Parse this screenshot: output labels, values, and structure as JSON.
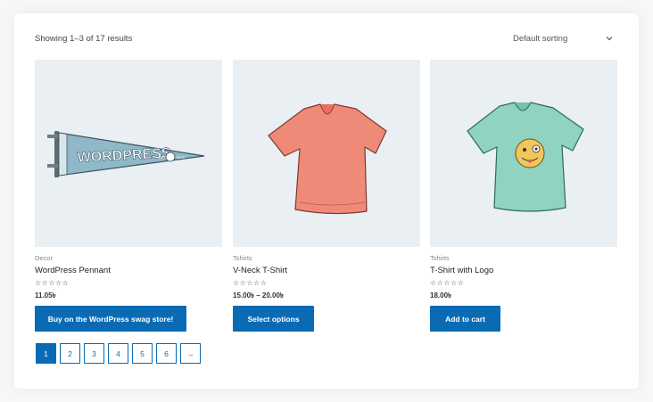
{
  "toolbar": {
    "result_count": "Showing 1–3 of 17 results",
    "sorting_selected": "Default sorting"
  },
  "products": [
    {
      "category": "Decor",
      "title": "WordPress Pennant",
      "rating": "☆☆☆☆☆",
      "price": "11.05৳",
      "button": "Buy on the WordPress swag store!",
      "image_icon": "pennant-image"
    },
    {
      "category": "Tshirts",
      "title": "V-Neck T-Shirt",
      "rating": "☆☆☆☆☆",
      "price": "15.00৳ – 20.00৳",
      "button": "Select options",
      "image_icon": "vneck-tshirt-image"
    },
    {
      "category": "Tshirts",
      "title": "T-Shirt with Logo",
      "rating": "☆☆☆☆☆",
      "price": "18.00৳",
      "button": "Add to cart",
      "image_icon": "tshirt-logo-image"
    }
  ],
  "pagination": {
    "pages": [
      "1",
      "2",
      "3",
      "4",
      "5",
      "6"
    ],
    "current": "1",
    "next": "→"
  },
  "colors": {
    "accent": "#0a6bb4",
    "thumb_bg": "#e9eff2",
    "pennant": "#8fb8c9",
    "tshirt_coral": "#f08a78",
    "tshirt_mint": "#8fd3c0"
  }
}
